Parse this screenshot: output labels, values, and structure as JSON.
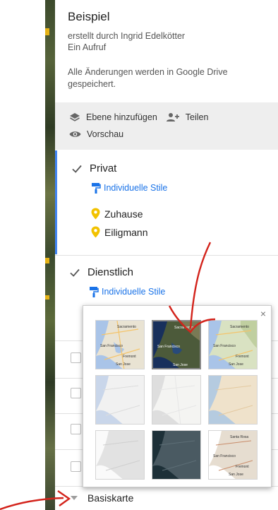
{
  "map": {
    "description_icons": [
      "satellite-map-strip"
    ]
  },
  "panel": {
    "title": "Beispiel",
    "created_by": "erstellt durch Ingrid Edelkötter",
    "views": "Ein Aufruf",
    "saved_notice": "Alle Änderungen werden in Google Drive gespeichert.",
    "toolbar": {
      "add_layer": "Ebene hinzufügen",
      "share": "Teilen",
      "preview": "Vorschau"
    },
    "layers": [
      {
        "name": "Privat",
        "checked": true,
        "styles_label": "Individuelle Stile",
        "places": [
          "Zuhause",
          "Eiligmann"
        ],
        "place_color": "#f2c200"
      },
      {
        "name": "Dienstlich",
        "checked": true,
        "styles_label": "Individuelle Stile"
      }
    ],
    "basemap_label": "Basiskarte"
  },
  "basemap_popup": {
    "close_glyph": "×",
    "styles": [
      {
        "name": "map",
        "selected": false
      },
      {
        "name": "satellite",
        "selected": true
      },
      {
        "name": "terrain",
        "selected": false
      },
      {
        "name": "light-political",
        "selected": false
      },
      {
        "name": "mono-city",
        "selected": false
      },
      {
        "name": "simple-atlas",
        "selected": false
      },
      {
        "name": "light-landmass",
        "selected": false
      },
      {
        "name": "dark-landmass",
        "selected": false
      },
      {
        "name": "whitewater",
        "selected": false
      }
    ],
    "tile_labels": {
      "sacramento": "Sacramento",
      "santa_rosa": "Santa Rosa",
      "san_francisco": "San Francisco",
      "fremont": "Fremont",
      "san_jose": "San Jose"
    }
  },
  "colors": {
    "accent": "#1a73e8",
    "layer_bar": "#4285f4",
    "annotation": "#d3231b"
  }
}
